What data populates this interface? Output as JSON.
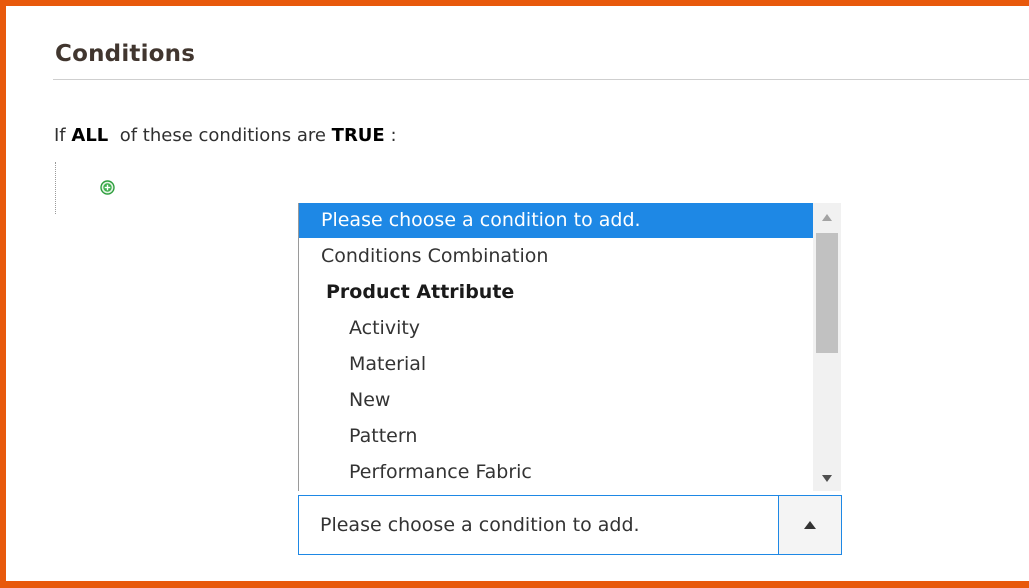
{
  "section": {
    "title": "Conditions"
  },
  "rule": {
    "prefix": "If",
    "aggregator": "ALL",
    "middle": "of these conditions are",
    "value": "TRUE",
    "suffix": ":"
  },
  "add_condition_icon": "plus-circle-icon",
  "condition_list": {
    "options": [
      {
        "label": "Please choose a condition to add.",
        "kind": "placeholder",
        "selected": true
      },
      {
        "label": "Conditions Combination",
        "kind": "option"
      },
      {
        "label": "Product Attribute",
        "kind": "group"
      },
      {
        "label": "Activity",
        "kind": "child"
      },
      {
        "label": "Material",
        "kind": "child"
      },
      {
        "label": "New",
        "kind": "child"
      },
      {
        "label": "Pattern",
        "kind": "child"
      },
      {
        "label": "Performance Fabric",
        "kind": "child"
      }
    ]
  },
  "condition_select": {
    "value": "Please choose a condition to add.",
    "arrow_icon": "triangle-up-icon"
  },
  "colors": {
    "frame_border": "#e8590c",
    "selection": "#1e88e5",
    "add_icon": "#2e9e3e"
  }
}
